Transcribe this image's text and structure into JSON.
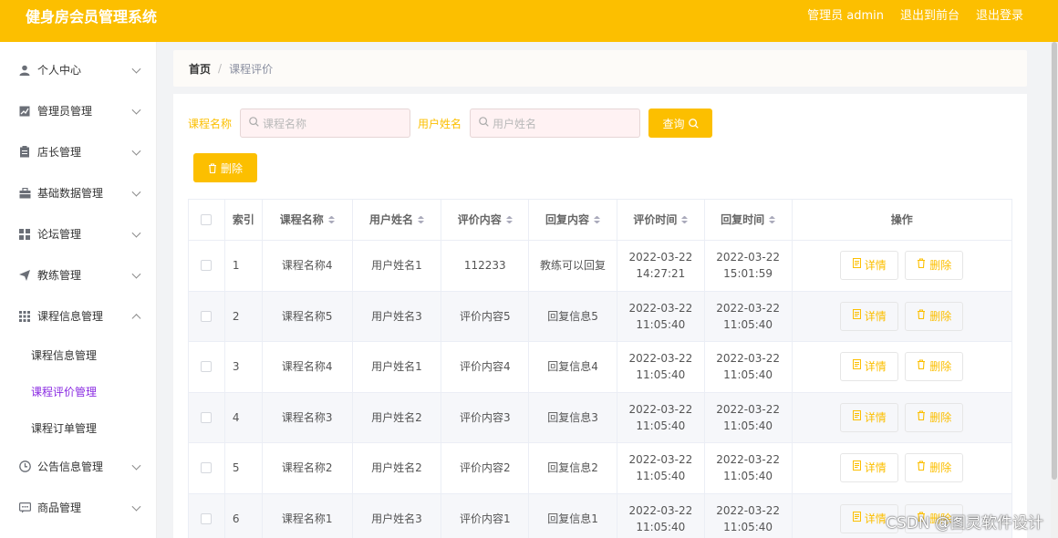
{
  "header": {
    "title": "健身房会员管理系统",
    "user": "管理员 admin",
    "back_to_front": "退出到前台",
    "logout": "退出登录"
  },
  "sidebar": {
    "items": [
      {
        "label": "个人中心",
        "icon": "user-icon"
      },
      {
        "label": "管理员管理",
        "icon": "chart-icon"
      },
      {
        "label": "店长管理",
        "icon": "clipboard-icon"
      },
      {
        "label": "基础数据管理",
        "icon": "briefcase-icon"
      },
      {
        "label": "论坛管理",
        "icon": "grid-icon"
      },
      {
        "label": "教练管理",
        "icon": "send-icon"
      },
      {
        "label": "课程信息管理",
        "icon": "apps-icon"
      },
      {
        "label": "公告信息管理",
        "icon": "clock-icon"
      },
      {
        "label": "商品管理",
        "icon": "chat-icon"
      }
    ],
    "submenu": [
      {
        "label": "课程信息管理"
      },
      {
        "label": "课程评价管理"
      },
      {
        "label": "课程订单管理"
      }
    ]
  },
  "breadcrumb": {
    "home": "首页",
    "separator": "/",
    "current": "课程评价"
  },
  "search": {
    "course_label": "课程名称",
    "course_placeholder": "课程名称",
    "user_label": "用户姓名",
    "user_placeholder": "用户姓名",
    "query_button": "查询"
  },
  "toolbar": {
    "delete_label": "删除"
  },
  "table": {
    "headers": [
      "索引",
      "课程名称",
      "用户姓名",
      "评价内容",
      "回复内容",
      "评价时间",
      "回复时间",
      "操作"
    ],
    "rows": [
      {
        "index": "1",
        "course": "课程名称4",
        "user": "用户姓名1",
        "content": "112233",
        "reply": "教练可以回复",
        "eval_time": "2022-03-22 14:27:21",
        "reply_time": "2022-03-22 15:01:59"
      },
      {
        "index": "2",
        "course": "课程名称5",
        "user": "用户姓名3",
        "content": "评价内容5",
        "reply": "回复信息5",
        "eval_time": "2022-03-22 11:05:40",
        "reply_time": "2022-03-22 11:05:40"
      },
      {
        "index": "3",
        "course": "课程名称4",
        "user": "用户姓名1",
        "content": "评价内容4",
        "reply": "回复信息4",
        "eval_time": "2022-03-22 11:05:40",
        "reply_time": "2022-03-22 11:05:40"
      },
      {
        "index": "4",
        "course": "课程名称3",
        "user": "用户姓名2",
        "content": "评价内容3",
        "reply": "回复信息3",
        "eval_time": "2022-03-22 11:05:40",
        "reply_time": "2022-03-22 11:05:40"
      },
      {
        "index": "5",
        "course": "课程名称2",
        "user": "用户姓名2",
        "content": "评价内容2",
        "reply": "回复信息2",
        "eval_time": "2022-03-22 11:05:40",
        "reply_time": "2022-03-22 11:05:40"
      },
      {
        "index": "6",
        "course": "课程名称1",
        "user": "用户姓名3",
        "content": "评价内容1",
        "reply": "回复信息1",
        "eval_time": "2022-03-22 11:05:40",
        "reply_time": "2022-03-22 11:05:40"
      }
    ],
    "detail_label": "详情",
    "delete_label": "删除"
  },
  "watermark": "CSDN @图灵软件设计",
  "colors": {
    "accent": "#fcbf00",
    "active_submenu": "#8a2be2"
  }
}
